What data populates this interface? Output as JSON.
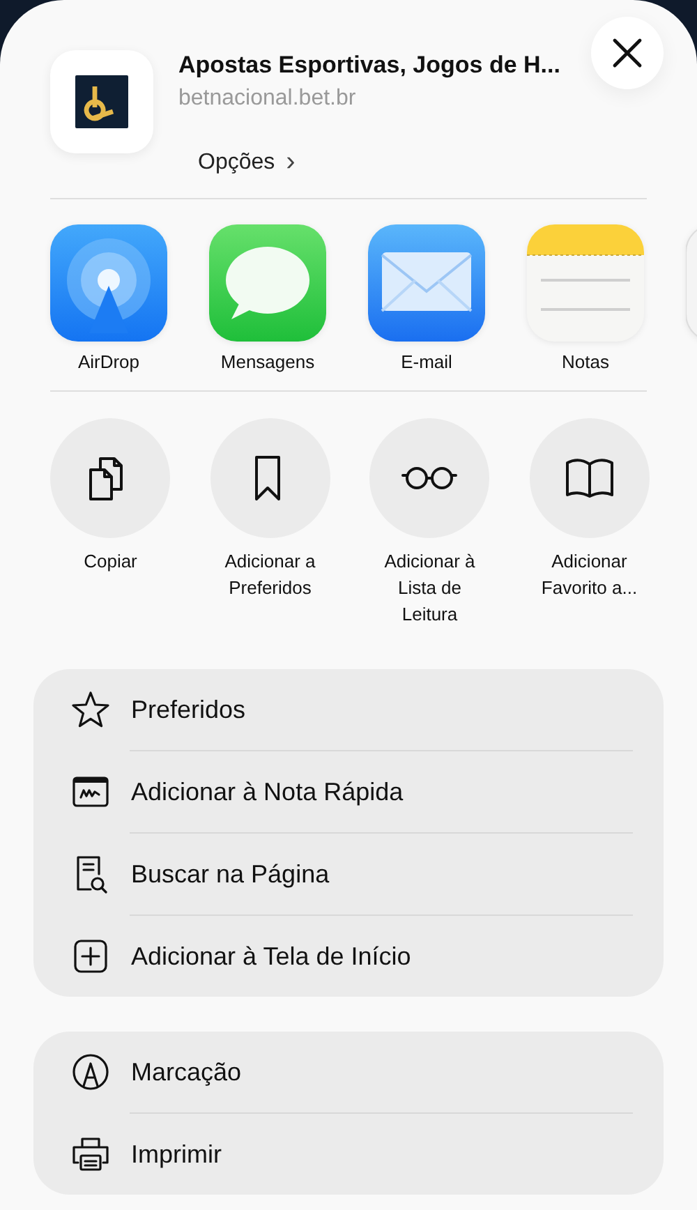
{
  "header": {
    "title": "Apostas Esportivas, Jogos de H...",
    "url": "betnacional.bet.br",
    "options": "Opções",
    "chevron": "›"
  },
  "apps": [
    {
      "kind": "airdrop",
      "label": "AirDrop"
    },
    {
      "kind": "messages",
      "label": "Mensagens"
    },
    {
      "kind": "mail",
      "label": "E-mail"
    },
    {
      "kind": "notes",
      "label": "Notas"
    },
    {
      "kind": "generic"
    }
  ],
  "actions": [
    {
      "kind": "copy",
      "label": "Copiar"
    },
    {
      "kind": "bookmark",
      "label": "Adicionar a\nPreferidos"
    },
    {
      "kind": "glasses",
      "label": "Adicionar à\nLista de\nLeitura"
    },
    {
      "kind": "book",
      "label": "Adicionar\nFavorito a..."
    }
  ],
  "menu_groups": [
    {
      "items": [
        {
          "kind": "star",
          "label": "Preferidos"
        },
        {
          "kind": "quicknote",
          "label": "Adicionar à Nota Rápida"
        },
        {
          "kind": "find",
          "label": "Buscar na Página"
        },
        {
          "kind": "addsquare",
          "label": "Adicionar à Tela de Início"
        }
      ]
    },
    {
      "items": [
        {
          "kind": "markup",
          "label": "Marcação"
        },
        {
          "kind": "printer",
          "label": "Imprimir"
        }
      ]
    }
  ]
}
